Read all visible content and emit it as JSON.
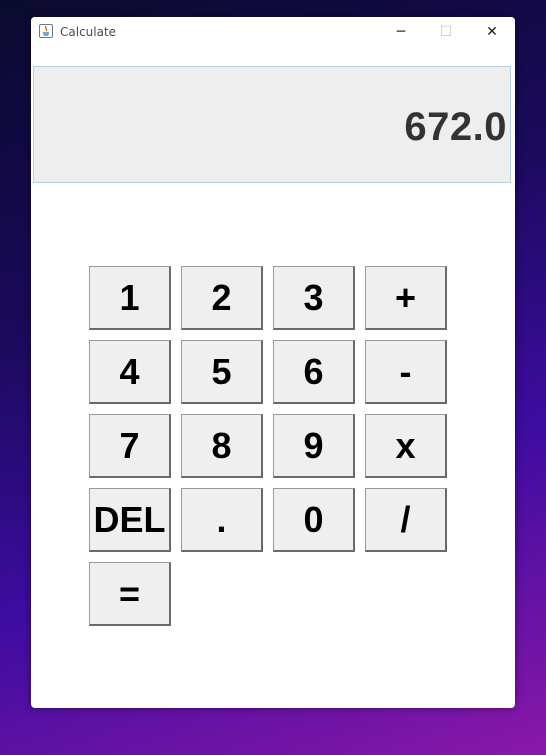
{
  "window": {
    "title": "Calculate",
    "controls": {
      "minimize": "─",
      "maximize": "☐",
      "close": "✕"
    }
  },
  "display": {
    "value": "672.0"
  },
  "keypad": {
    "keys": [
      {
        "label": "1"
      },
      {
        "label": "2"
      },
      {
        "label": "3"
      },
      {
        "label": "+"
      },
      {
        "label": "4"
      },
      {
        "label": "5"
      },
      {
        "label": "6"
      },
      {
        "label": "-"
      },
      {
        "label": "7"
      },
      {
        "label": "8"
      },
      {
        "label": "9"
      },
      {
        "label": "x"
      },
      {
        "label": "DEL"
      },
      {
        "label": "."
      },
      {
        "label": "0"
      },
      {
        "label": "/"
      },
      {
        "label": "="
      }
    ]
  },
  "colors": {
    "display_bg": "#eeeeee",
    "display_text": "#333333",
    "key_bg": "#efefef"
  }
}
